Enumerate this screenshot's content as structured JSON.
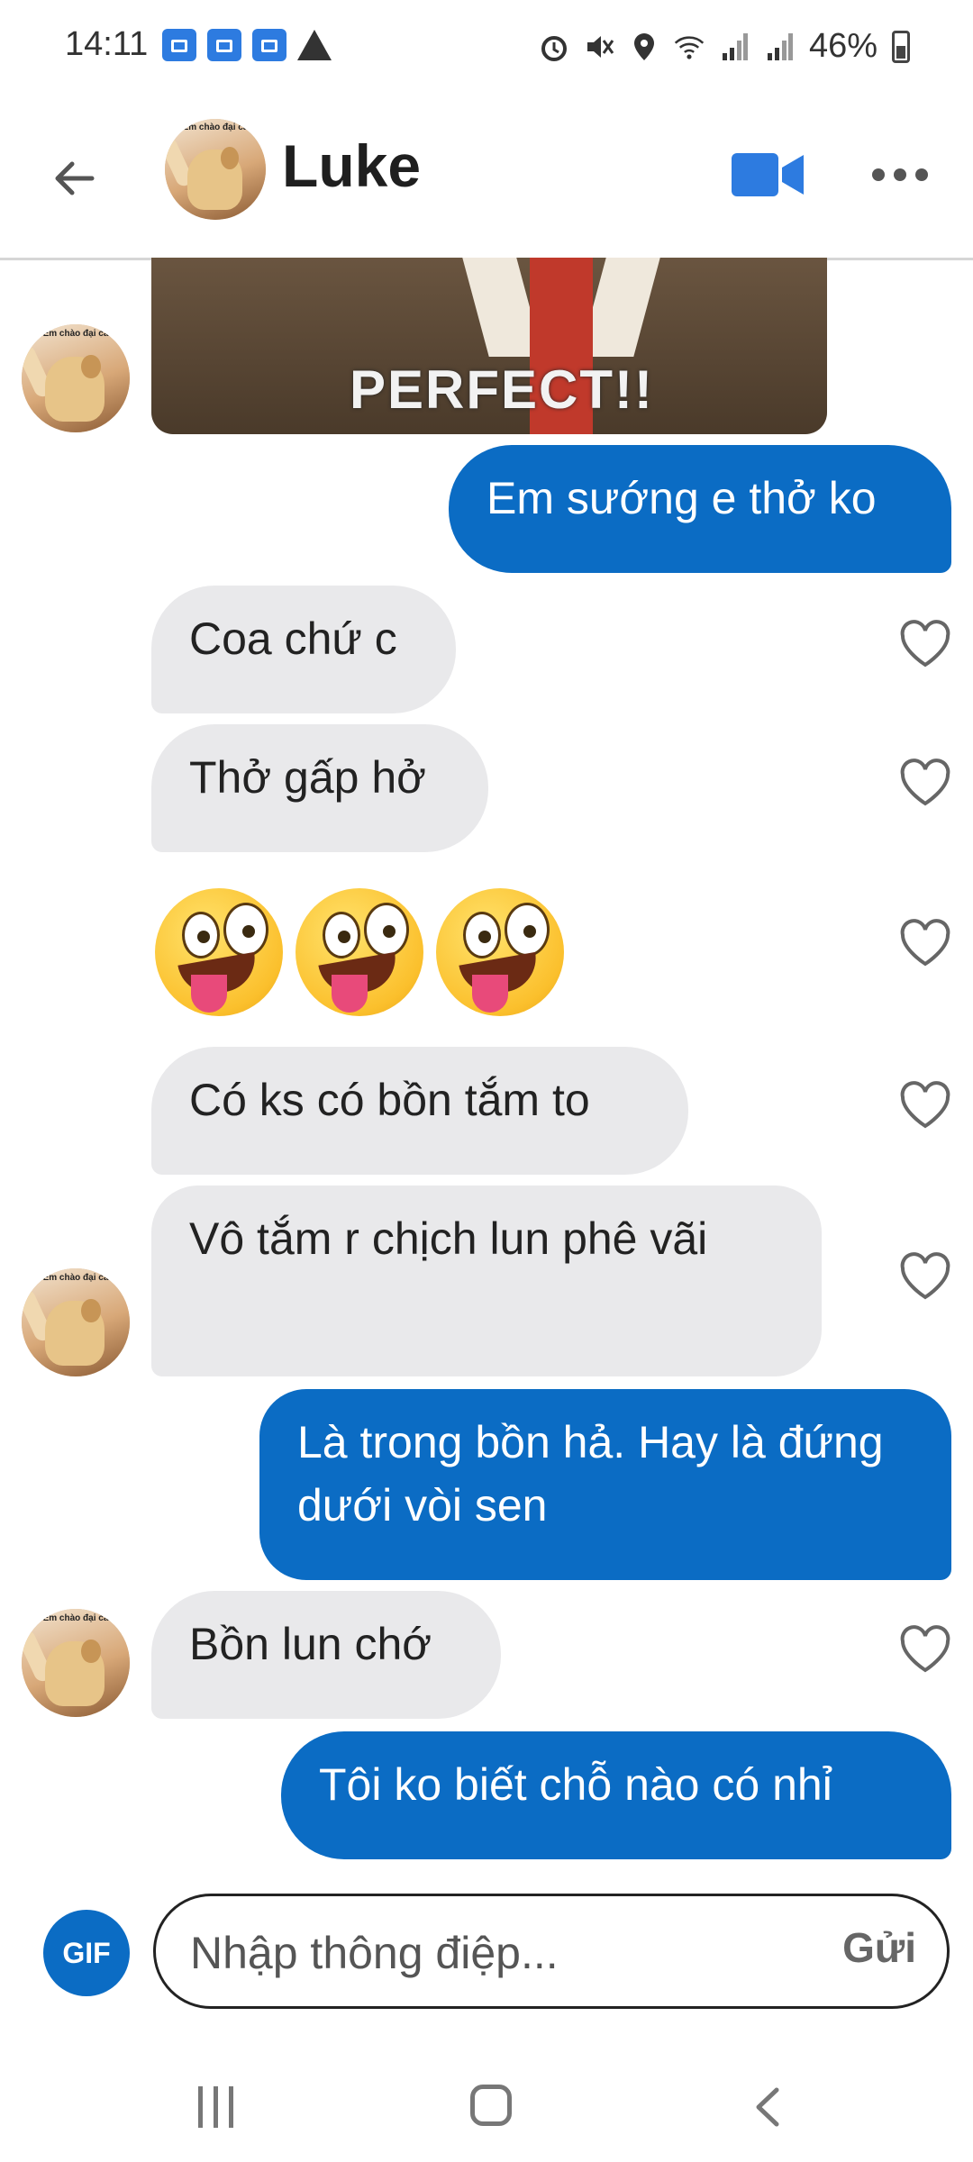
{
  "status_bar": {
    "time": "14:11",
    "battery": "46%"
  },
  "header": {
    "contact_name": "Luke"
  },
  "messages": {
    "gif_text": "PERFECT!!",
    "m1": "Em sướng e thở ko",
    "m2": "Coa chứ c",
    "m3": "Thở gấp hở",
    "m4": "Có ks có bồn tắm to",
    "m5": "Vô tắm r chịch lun phê vãi",
    "m6": "Là trong bồn hả. Hay là đứng dưới vòi sen",
    "m7": "Bồn lun chớ",
    "m8": "Tôi ko biết chỗ nào có nhỉ"
  },
  "avatar_caption": "Em chào đại ca",
  "composer": {
    "gif_label": "GIF",
    "placeholder": "Nhập thông điệp...",
    "send_label": "Gửi"
  },
  "colors": {
    "outgoing_bubble": "#0b6cc4",
    "incoming_bubble": "#e9e9eb",
    "accent": "#0b6cc4"
  },
  "icons": [
    "back-arrow-icon",
    "video-call-icon",
    "more-icon",
    "heart-icon",
    "gif-icon",
    "recent-apps-icon",
    "home-icon",
    "nav-back-icon"
  ]
}
